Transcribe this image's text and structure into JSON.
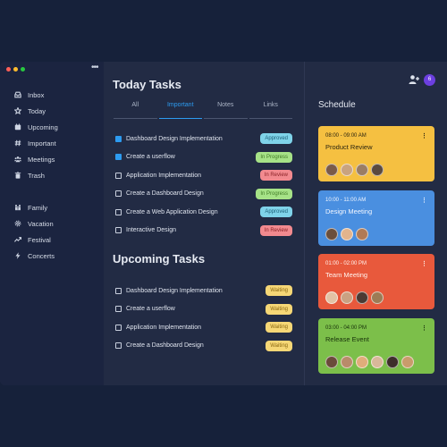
{
  "window": {
    "traffic_lights": [
      "#ff5f57",
      "#ffbd2e",
      "#28c840"
    ]
  },
  "sidebar": {
    "groups": [
      [
        {
          "label": "Inbox",
          "icon": "inbox-icon"
        },
        {
          "label": "Today",
          "icon": "star-icon"
        },
        {
          "label": "Upcoming",
          "icon": "calendar-icon"
        },
        {
          "label": "Important",
          "icon": "hash-icon"
        },
        {
          "label": "Meetings",
          "icon": "users-icon"
        },
        {
          "label": "Trash",
          "icon": "trash-icon"
        }
      ],
      [
        {
          "label": "Family",
          "icon": "family-icon"
        },
        {
          "label": "Vacation",
          "icon": "settings-icon"
        },
        {
          "label": "Festival",
          "icon": "trend-icon"
        },
        {
          "label": "Concerts",
          "icon": "bolt-icon"
        }
      ]
    ]
  },
  "main": {
    "today_title": "Today Tasks",
    "tabs": [
      "All",
      "Important",
      "Notes",
      "Links"
    ],
    "active_tab": 1,
    "today_tasks": [
      {
        "label": "Dashboard Design Implementation",
        "status": "Approved",
        "checked": true
      },
      {
        "label": "Create a userflow",
        "status": "In Progress",
        "checked": true
      },
      {
        "label": "Application Implementation",
        "status": "In Review",
        "checked": false
      },
      {
        "label": "Create a Dashboard Design",
        "status": "In Progress",
        "checked": false
      },
      {
        "label": "Create a Web Application Design",
        "status": "Approved",
        "checked": false
      },
      {
        "label": "Interactive Design",
        "status": "In Review",
        "checked": false
      }
    ],
    "upcoming_title": "Upcoming Tasks",
    "upcoming_tasks": [
      {
        "label": "Dashboard Design Implementation",
        "status": "Waiting",
        "checked": false
      },
      {
        "label": "Create a userflow",
        "status": "Waiting",
        "checked": false
      },
      {
        "label": "Application Implementation",
        "status": "Waiting",
        "checked": false
      },
      {
        "label": "Create a Dashboard Design",
        "status": "Waiting",
        "checked": false
      }
    ]
  },
  "schedule": {
    "title": "Schedule",
    "notification_count": "6",
    "events": [
      {
        "time": "08:00 - 09:00 AM",
        "title": "Product Review",
        "color": "#f5c041",
        "text_color": "#2b2410",
        "avatars": [
          "#7a5a48",
          "#c9a37f",
          "#9a7d64",
          "#5b4a3e"
        ]
      },
      {
        "time": "10:00 - 11:00 AM",
        "title": "Design Meeting",
        "color": "#4a8fe0",
        "text_color": "#f2f6ff",
        "avatars": [
          "#6b4f3c",
          "#e2b48d",
          "#b07a55"
        ]
      },
      {
        "time": "01:00 - 02:00 PM",
        "title": "Team Meeting",
        "color": "#e8593c",
        "text_color": "#fff3ee",
        "avatars": [
          "#e3c3a5",
          "#caa182",
          "#4a3a33",
          "#9d7b55"
        ]
      },
      {
        "time": "03:00 - 04:00 PM",
        "title": "Release Event",
        "color": "#7cbf4a",
        "text_color": "#17300a",
        "avatars": [
          "#6a4b3a",
          "#b98b6a",
          "#e0ad7a",
          "#d9b89a",
          "#3d2f2a",
          "#c99b6b"
        ]
      }
    ]
  }
}
